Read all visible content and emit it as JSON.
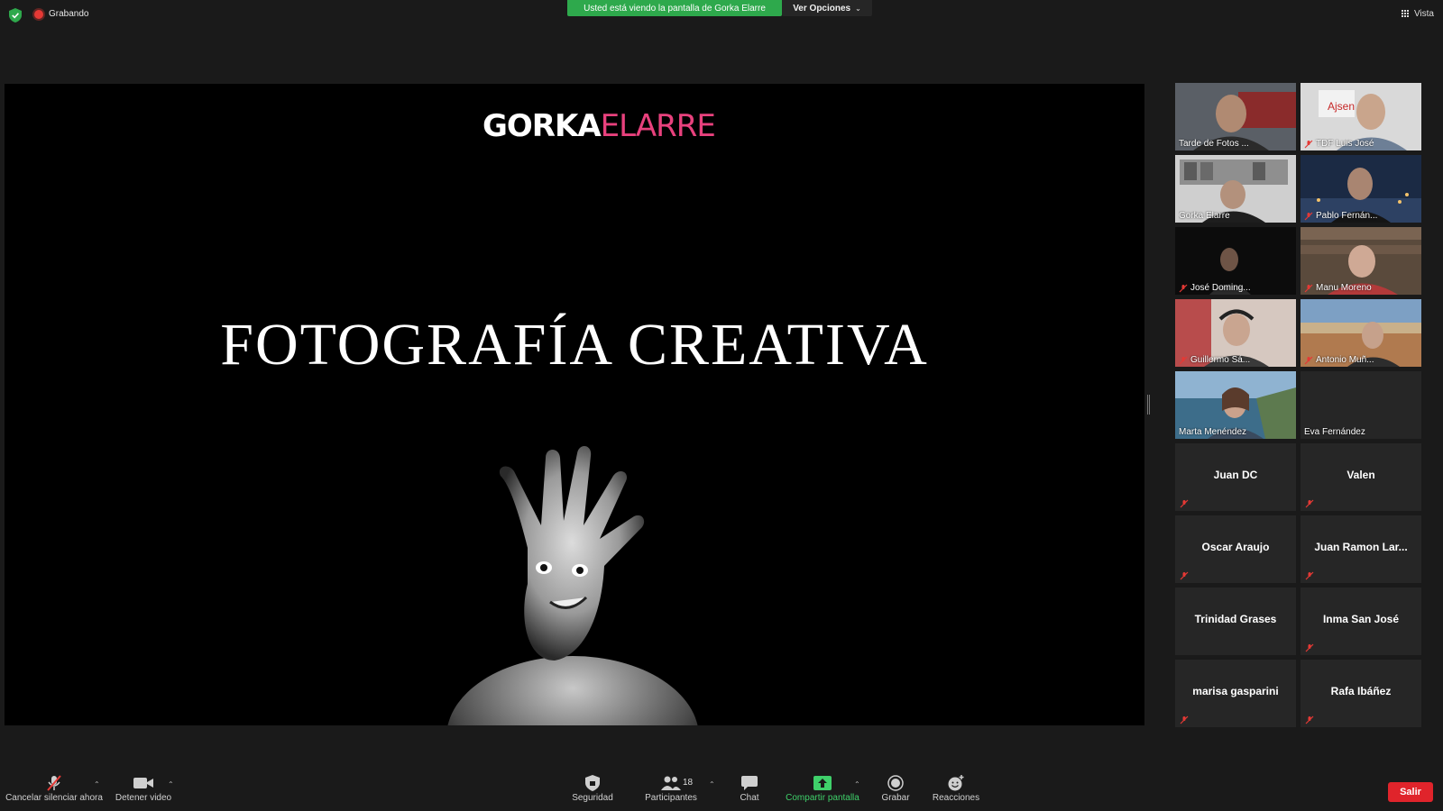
{
  "topbar": {
    "recording_label": "Grabando",
    "banner_text": "Usted está viendo la pantalla de Gorka Elarre",
    "view_options_label": "Ver Opciones",
    "view_label": "Vista"
  },
  "slide": {
    "logo_part1": "GORKA",
    "logo_part2": "ELARRE",
    "title": "FOTOGRAFÍA CREATIVA"
  },
  "participants": [
    {
      "name": "Tarde de Fotos ...",
      "muted": false,
      "video": true
    },
    {
      "name": "TDF Luis José",
      "muted": true,
      "video": true
    },
    {
      "name": "Gorka Elarre",
      "muted": false,
      "video": true,
      "active": true
    },
    {
      "name": "Pablo Fernán...",
      "muted": true,
      "video": true
    },
    {
      "name": "José Doming...",
      "muted": true,
      "video": true
    },
    {
      "name": "Manu Moreno",
      "muted": true,
      "video": true
    },
    {
      "name": "Guillermo Sá...",
      "muted": true,
      "video": true
    },
    {
      "name": "Antonio Muñ...",
      "muted": true,
      "video": true
    },
    {
      "name": "Marta Menéndez",
      "muted": false,
      "video": true
    },
    {
      "name": "Eva Fernández",
      "muted": false,
      "video": false
    },
    {
      "name": "Juan DC",
      "muted": true,
      "video": false
    },
    {
      "name": "Valen",
      "muted": true,
      "video": false
    },
    {
      "name": "Oscar Araujo",
      "muted": true,
      "video": false
    },
    {
      "name": "Juan Ramon Lar...",
      "muted": true,
      "video": false
    },
    {
      "name": "Trinidad Grases",
      "muted": false,
      "video": false
    },
    {
      "name": "Inma San José",
      "muted": true,
      "video": false
    },
    {
      "name": "marisa gasparini",
      "muted": true,
      "video": false
    },
    {
      "name": "Rafa Ibáñez",
      "muted": true,
      "video": false
    }
  ],
  "toolbar": {
    "unmute_label": "Cancelar silenciar ahora",
    "stop_video_label": "Detener video",
    "security_label": "Seguridad",
    "participants_label": "Participantes",
    "participants_count": "18",
    "chat_label": "Chat",
    "share_label": "Compartir pantalla",
    "record_label": "Grabar",
    "reactions_label": "Reacciones",
    "leave_label": "Salir"
  },
  "colors": {
    "banner_green": "#2ea94c",
    "share_green": "#3fd06a",
    "leave_red": "#e0242b",
    "active_speaker": "#d5e84a",
    "logo_pink": "#e8417d"
  }
}
